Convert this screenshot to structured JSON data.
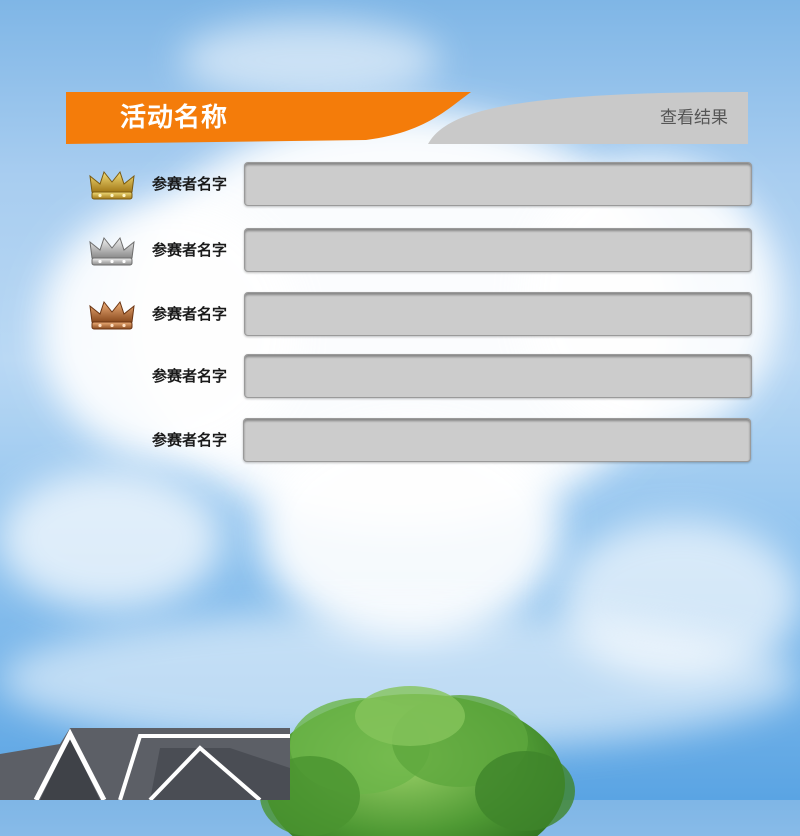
{
  "header": {
    "title": "活动名称",
    "results_label": "查看结果",
    "accent": "#f47c0a"
  },
  "entries": [
    {
      "name": "参赛者名字",
      "medal": "gold-crown-icon"
    },
    {
      "name": "参赛者名字",
      "medal": "silver-crown-icon"
    },
    {
      "name": "参赛者名字",
      "medal": "bronze-crown-icon"
    },
    {
      "name": "参赛者名字",
      "medal": ""
    },
    {
      "name": "参赛者名字",
      "medal": ""
    }
  ]
}
